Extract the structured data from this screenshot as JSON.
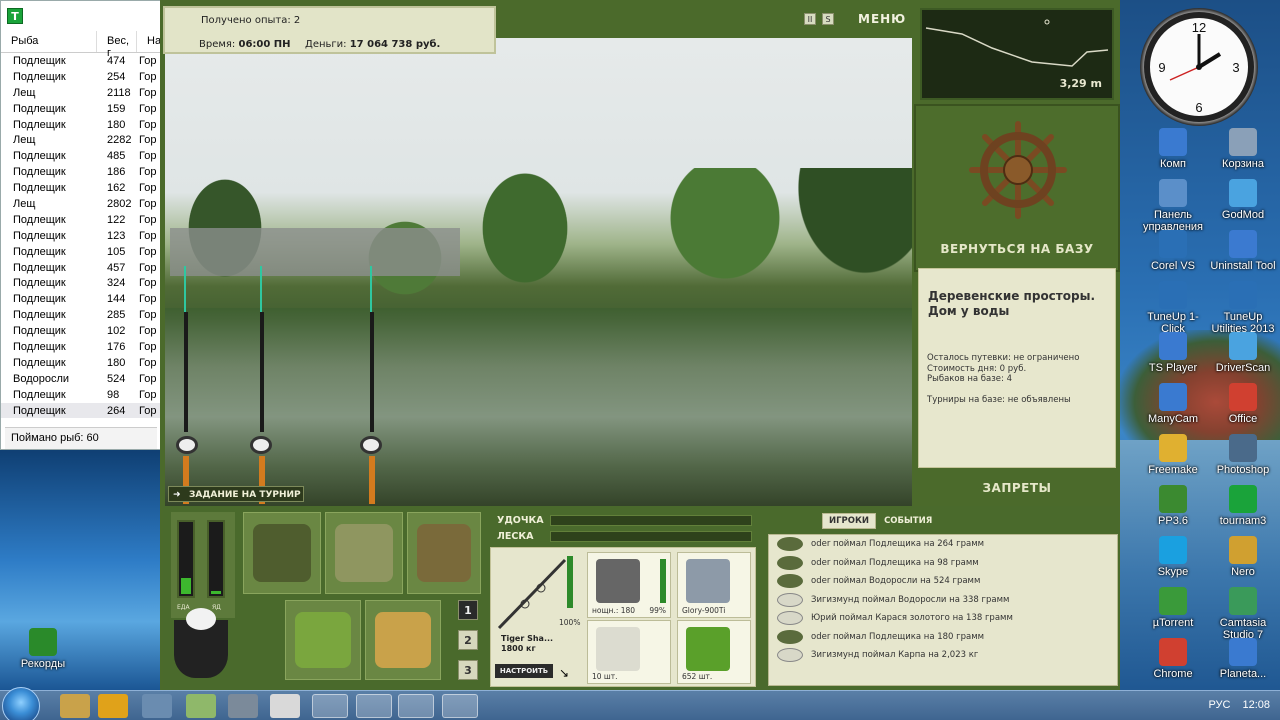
{
  "catch_list": {
    "headers": [
      "Рыба",
      "Вес, г",
      "На"
    ],
    "rows": [
      [
        "Подлещик",
        "474",
        "Гор"
      ],
      [
        "Подлещик",
        "254",
        "Гор"
      ],
      [
        "Лещ",
        "2118",
        "Гор"
      ],
      [
        "Подлещик",
        "159",
        "Гор"
      ],
      [
        "Подлещик",
        "180",
        "Гор"
      ],
      [
        "Лещ",
        "2282",
        "Гор"
      ],
      [
        "Подлещик",
        "485",
        "Гор"
      ],
      [
        "Подлещик",
        "186",
        "Гор"
      ],
      [
        "Подлещик",
        "162",
        "Гор"
      ],
      [
        "Лещ",
        "2802",
        "Гор"
      ],
      [
        "Подлещик",
        "122",
        "Гор"
      ],
      [
        "Подлещик",
        "123",
        "Гор"
      ],
      [
        "Подлещик",
        "105",
        "Гор"
      ],
      [
        "Подлещик",
        "457",
        "Гор"
      ],
      [
        "Подлещик",
        "324",
        "Гор"
      ],
      [
        "Подлещик",
        "144",
        "Гор"
      ],
      [
        "Подлещик",
        "285",
        "Гор"
      ],
      [
        "Подлещик",
        "102",
        "Гор"
      ],
      [
        "Подлещик",
        "176",
        "Гор"
      ],
      [
        "Подлещик",
        "180",
        "Гор"
      ],
      [
        "Водоросли",
        "524",
        "Гор"
      ],
      [
        "Подлещик",
        "98",
        "Гор"
      ],
      [
        "Подлещик",
        "264",
        "Гор"
      ]
    ],
    "status": "Поймано рыб: 60"
  },
  "game": {
    "experience": "Получено опыта: 2",
    "time_label": "Время:",
    "time_value": "06:00 ПН",
    "money_label": "Деньги:",
    "money_value": "17 064 738 руб.",
    "menu": "МЕНЮ",
    "task_button": "ЗАДАНИЕ НА ТУРНИР",
    "depth": "3,29 m",
    "return_base": "ВЕРНУТЬСЯ НА БАЗУ",
    "location_title": "Деревенские просторы. Дом у воды",
    "location_details": [
      "Осталось путевки: не ограничено",
      "Стоимость дня: 0 руб.",
      "Рыбаков на базе: 4",
      "",
      "Турниры на базе: не объявлены"
    ],
    "bans": "ЗАПРЕТЫ",
    "gauge_food": "ЕДА",
    "gauge_poison": "ЯД",
    "pages": [
      "1",
      "2",
      "3"
    ],
    "tackle": {
      "rod_label": "УДОЧКА",
      "line_label": "ЛЕСКА",
      "rod_name": "Tiger Sha...",
      "rod_weight": "1800 кг",
      "rod_pct": "100%",
      "setup_button": "НАСТРОИТЬ",
      "reel_caption": "нощн.: 180",
      "reel_pct": "99%",
      "line_caption": "Glory-900Ti",
      "hook_caption": "10 шт.",
      "bait_caption": "652 шт."
    },
    "feed_tabs": [
      "ИГРОКИ",
      "СОБЫТИЯ"
    ],
    "feed": [
      {
        "text": "oder поймал Подлещика на 264 грамм",
        "icon": "dark"
      },
      {
        "text": "oder поймал Подлещика на 98 грамм",
        "icon": "dark"
      },
      {
        "text": "oder поймал Водоросли на 524 грамм",
        "icon": "dark"
      },
      {
        "text": "Зигизмунд поймал Водоросли на 338 грамм",
        "icon": "light"
      },
      {
        "text": "Юрий поймал Карася золотого на 138 грамм",
        "icon": "light"
      },
      {
        "text": "oder поймал Подлещика на 180 грамм",
        "icon": "dark"
      },
      {
        "text": "Зигизмунд поймал Карпа на 2,023 кг",
        "icon": "light"
      }
    ]
  },
  "desktop": {
    "icons_left": [
      "Рекорды"
    ],
    "icons_right": [
      [
        "Комп",
        "Корзина"
      ],
      [
        "Панель управления",
        "GodMod"
      ],
      [
        "Corel VS",
        "Uninstall Tool"
      ],
      [
        "TuneUp 1-Click",
        "TuneUp Utilities 2013"
      ],
      [
        "TS Player",
        "DriverScan"
      ],
      [
        "ManyCam",
        "Office"
      ],
      [
        "Freemake",
        "Photoshop"
      ],
      [
        "PP3.6",
        "tournam3"
      ],
      [
        "Skype",
        "Nero"
      ],
      [
        "µTorrent",
        "Camtasia Studio 7"
      ],
      [
        "Chrome",
        "Planeta..."
      ]
    ]
  },
  "taskbar": {
    "lang": "РУС",
    "time": "12:08"
  }
}
